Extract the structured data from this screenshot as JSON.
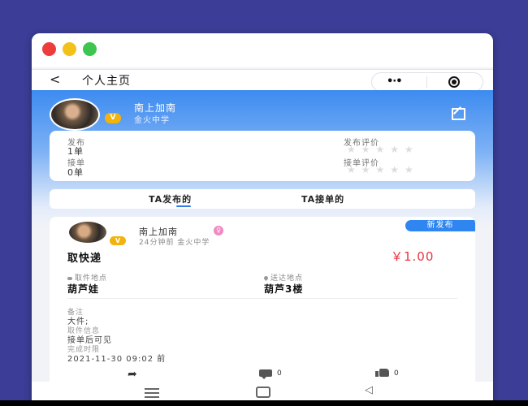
{
  "nav": {
    "back": "<",
    "title": "个人主页"
  },
  "profile": {
    "name": "南上加南",
    "school": "金火中学",
    "badge": "V"
  },
  "stats": {
    "published_label": "发布",
    "published_value": "1单",
    "taken_label": "接单",
    "taken_value": "0单",
    "publish_rating_label": "发布评价",
    "take_rating_label": "接单评价",
    "stars": "★★★★★"
  },
  "tabs": {
    "published": "TA发布的",
    "taken": "TA接单的"
  },
  "post": {
    "poster_name": "南上加南",
    "gender_symbol": "♀",
    "badge": "V",
    "meta": "24分钟前 金火中学",
    "status": "新发布",
    "title": "取快递",
    "price": "￥1.00",
    "pickup_label": "取件地点",
    "pickup_value": "葫芦娃",
    "delivery_label": "送达地点",
    "delivery_value": "葫芦3楼",
    "note_label": "备注",
    "note_value": "大件;",
    "pickup_info_label": "取件信息",
    "pickup_info_value": "接单后可见",
    "deadline_label": "完成时限",
    "deadline_value": "2021-11-30 09:02 前",
    "comment_count": "0",
    "like_count": "0"
  },
  "sysnav": {
    "back_symbol": "◁"
  },
  "colors": {
    "accent": "#2e7be9",
    "price": "#e8333e",
    "badge": "#f2b40c",
    "background": "#3b3d96"
  }
}
